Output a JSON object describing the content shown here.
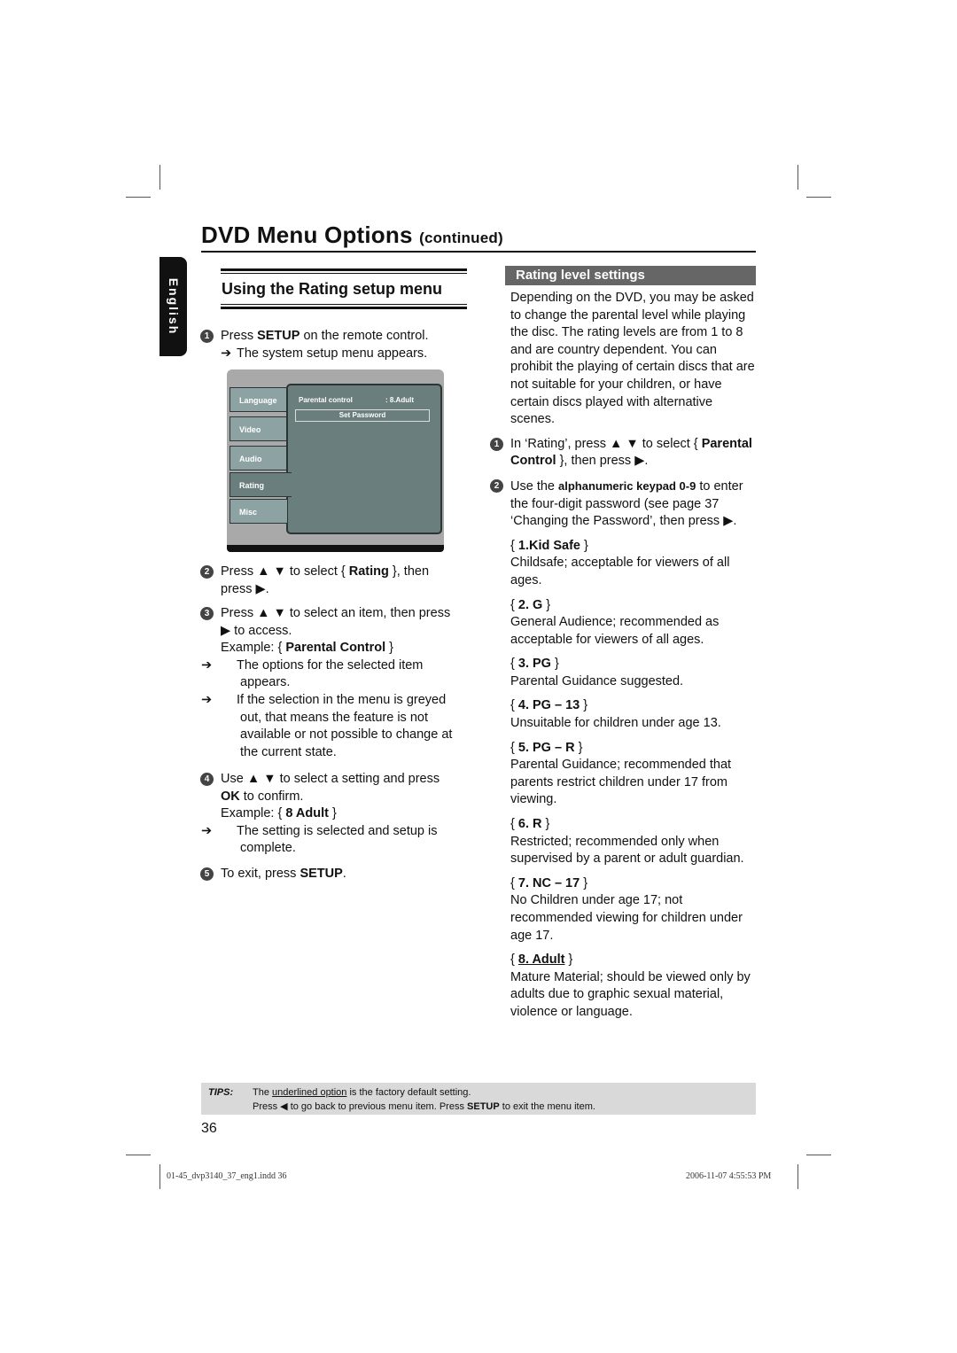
{
  "header": {
    "title": "DVD Menu Options",
    "continued": "(continued)"
  },
  "language_tab": "English",
  "left": {
    "section_title": "Using the Rating setup menu",
    "steps": [
      {
        "num": "1",
        "pre": "Press ",
        "bold": "SETUP",
        "post": " on the remote control.",
        "result": "The system setup menu appears."
      },
      {
        "num": "2",
        "line1_pre": "Press ▲ ▼ to select { ",
        "line1_bold": "Rating",
        "line1_post": " }, then",
        "line2": "press ▶."
      },
      {
        "num": "3",
        "line1": "Press ▲ ▼ to select an item, then press",
        "line2": "▶ to access.",
        "example_pre": "Example: { ",
        "example_bold": "Parental Control",
        "example_post": " }",
        "result1": "The options for the selected item appears.",
        "result2": "If the selection in the menu is greyed out, that means the feature is not available or not possible to change at the current state."
      },
      {
        "num": "4",
        "line1": "Use ▲ ▼ to select a setting and press",
        "line2_bold": "OK",
        "line2_post": " to confirm.",
        "example_pre": "Example: { ",
        "example_bold": "8 Adult",
        "example_post": " }",
        "result": "The setting is selected and setup is complete."
      },
      {
        "num": "5",
        "pre": "To exit, press ",
        "bold": "SETUP",
        "post": "."
      }
    ],
    "menu_screenshot": {
      "tabs": [
        "Language",
        "Video",
        "Audio",
        "Rating",
        "Misc"
      ],
      "active_tab": "Rating",
      "parental_control_label": "Parental control",
      "parental_control_value": ": 8.Adult",
      "set_password": "Set Password"
    }
  },
  "right": {
    "section_title": "Rating level settings",
    "intro": "Depending on the DVD, you may be asked to change the parental level while playing the disc. The rating levels are from 1 to 8 and are country dependent. You can prohibit the playing of certain discs that are not suitable for your children, or have certain discs played with alternative scenes.",
    "steps": [
      {
        "num": "1",
        "pre": "In ‘Rating’, press ▲ ▼ to select { ",
        "bold": "Parental Control",
        "post": " }, then press ▶."
      },
      {
        "num": "2",
        "pre": "Use the ",
        "bold": "alphanumeric keypad 0-9",
        "post": " to enter the four-digit password (see page 37 ‘Changing the Password’, then press ▶."
      }
    ],
    "ratings": [
      {
        "label": "1.Kid Safe",
        "desc": "Childsafe; acceptable for viewers of all ages.",
        "default": false
      },
      {
        "label": "2. G",
        "desc": "General Audience; recommended as acceptable for viewers of all ages.",
        "default": false
      },
      {
        "label": "3. PG",
        "desc": "Parental Guidance suggested.",
        "default": false
      },
      {
        "label": "4. PG – 13",
        "desc": "Unsuitable for children under age 13.",
        "default": false
      },
      {
        "label": "5. PG – R",
        "desc": "Parental Guidance; recommended that parents restrict children under 17 from viewing.",
        "default": false
      },
      {
        "label": "6. R",
        "desc": "Restricted; recommended only when supervised by a parent or adult guardian.",
        "default": false
      },
      {
        "label": "7. NC – 17",
        "desc": "No Children under age 17; not recommended viewing for children under age 17.",
        "default": false
      },
      {
        "label": "8. Adult",
        "desc": "Mature Material; should be viewed only by adults due to graphic sexual material, violence or language.",
        "default": true
      }
    ]
  },
  "tips": {
    "label": "TIPS:",
    "line1_pre": "The ",
    "line1_underlined": "underlined option",
    "line1_post": " is the factory default setting.",
    "line2_pre": "Press ◀ to go back to previous menu item. Press ",
    "line2_bold": "SETUP",
    "line2_post": " to exit the menu item."
  },
  "page_number": "36",
  "footer": {
    "file": "01-45_dvp3140_37_eng1.indd   36",
    "timestamp": "2006-11-07   4:55:53 PM"
  },
  "symbols": {
    "arrow": "➔",
    "brace_open": "{ ",
    "brace_close": " }"
  }
}
